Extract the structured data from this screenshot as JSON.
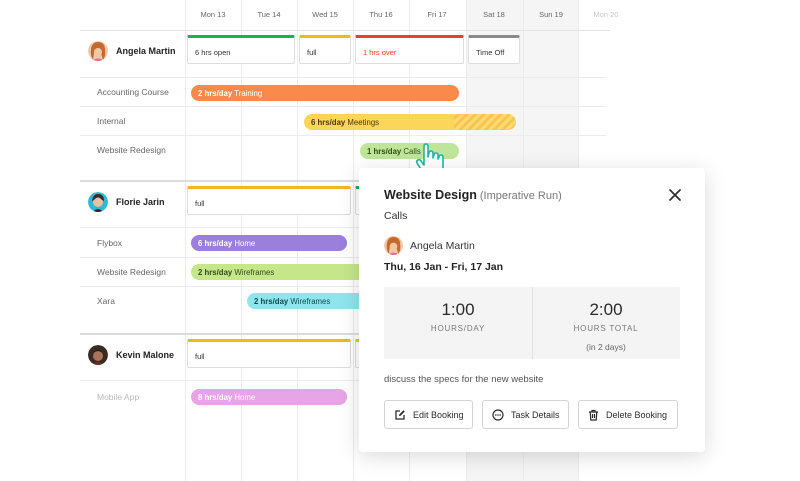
{
  "days": [
    "Mon 13",
    "Tue 14",
    "Wed 15",
    "Thu 16",
    "Fri 17",
    "Sat 18",
    "Sun 19",
    "Mon 20"
  ],
  "people": [
    {
      "name": "Angela Martin",
      "capacity": [
        "6 hrs open",
        "full",
        "1 hrs over",
        "Time Off"
      ],
      "projects": [
        {
          "name": "Accounting Course",
          "bar_hours": "2 hrs/day",
          "bar_task": "Training"
        },
        {
          "name": "Internal",
          "bar_hours": "6 hrs/day",
          "bar_task": "Meetings"
        },
        {
          "name": "Website Redesign",
          "bar_hours": "1 hrs/day",
          "bar_task": "Calls"
        }
      ]
    },
    {
      "name": "Florie Jarin",
      "capacity": [
        "full"
      ],
      "projects": [
        {
          "name": "Flybox",
          "bar_hours": "6 hrs/day",
          "bar_task": "Home"
        },
        {
          "name": "Website Redesign",
          "bar_hours": "2 hrs/day",
          "bar_task": "Wireframes"
        },
        {
          "name": "Xara",
          "bar_hours": "2 hrs/day",
          "bar_task": "Wireframes"
        }
      ]
    },
    {
      "name": "Kevin Malone",
      "capacity": [
        "full"
      ],
      "projects": [
        {
          "name": "Mobile App",
          "bar_hours": "8 hrs/day",
          "bar_task": "Home"
        }
      ]
    }
  ],
  "colors": {
    "capacity_open": "#22b04b",
    "capacity_full": "#f2b81c",
    "capacity_over": "#e0462a",
    "capacity_off": "#8a8a8a",
    "training": "#f98a4b",
    "meetings": "#fbd65a",
    "calls": "#bfe59a",
    "home": "#9b7fdc",
    "wireframes": "#c6e68a",
    "xara": "#8ee6ec",
    "mobile": "#e7a4e6"
  },
  "popover": {
    "title": "Website Design",
    "subtitle": "(Imperative Run)",
    "task": "Calls",
    "person": "Angela Martin",
    "dates": "Thu, 16 Jan - Fri, 17 Jan",
    "hours_per_day": "1:00",
    "hours_per_day_label": "HOURS/DAY",
    "hours_total": "2:00",
    "hours_total_label": "HOURS TOTAL",
    "hours_total_note": "(in 2 days)",
    "note": "discuss the specs for the new website",
    "buttons": {
      "edit": "Edit Booking",
      "details": "Task Details",
      "delete": "Delete Booking"
    }
  },
  "icons": [
    "close-icon",
    "cursor-hand-icon",
    "edit-icon",
    "more-icon",
    "trash-icon"
  ]
}
